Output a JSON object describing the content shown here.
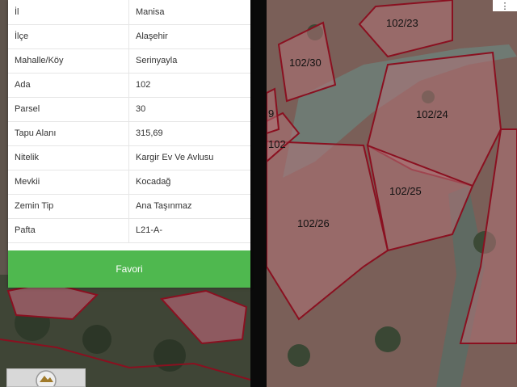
{
  "info_table": {
    "rows": [
      {
        "key": "İl",
        "value": "Manisa"
      },
      {
        "key": "İlçe",
        "value": "Alaşehir"
      },
      {
        "key": "Mahalle/Köy",
        "value": "Serinyayla"
      },
      {
        "key": "Ada",
        "value": "102"
      },
      {
        "key": "Parsel",
        "value": "30"
      },
      {
        "key": "Tapu Alanı",
        "value": "315,69"
      },
      {
        "key": "Nitelik",
        "value": "Kargir Ev Ve Avlusu"
      },
      {
        "key": "Mevkii",
        "value": "Kocadağ"
      },
      {
        "key": "Zemin Tip",
        "value": "Ana Taşınmaz"
      },
      {
        "key": "Pafta",
        "value": "L21-A-"
      }
    ],
    "favorite_button_label": "Favori"
  },
  "map": {
    "parcel_labels": [
      "102/23",
      "102/30",
      "102/24",
      "102/25",
      "102/26",
      "102",
      "9"
    ]
  },
  "colors": {
    "button_green": "#4fb84f",
    "parcel_border": "#8a1020"
  },
  "icons": {
    "corner": "more-icon"
  }
}
